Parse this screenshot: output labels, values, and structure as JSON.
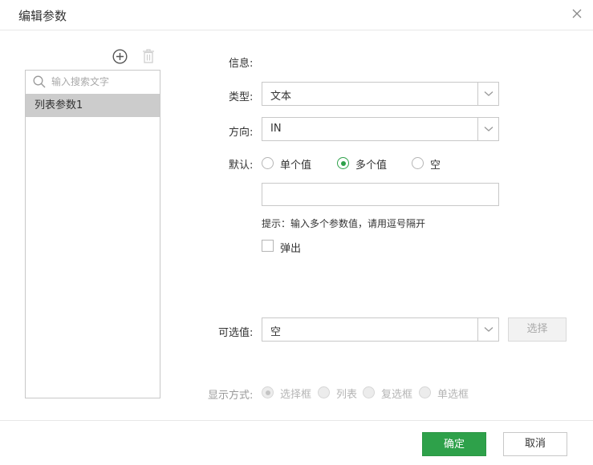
{
  "dialog": {
    "title": "编辑参数"
  },
  "left_panel": {
    "search_placeholder": "输入搜索文字",
    "items": [
      {
        "label": "列表参数1"
      }
    ]
  },
  "form": {
    "info_label": "信息:",
    "type_label": "类型:",
    "type_value": "文本",
    "direction_label": "方向:",
    "direction_value": "IN",
    "default_label": "默认:",
    "default_options": [
      "单个值",
      "多个值",
      "空"
    ],
    "default_selected": "多个值",
    "default_input_value": "",
    "hint": "提示：输入多个参数值，请用逗号隔开",
    "popup_label": "弹出",
    "optional_label": "可选值:",
    "optional_value": "空",
    "select_button": "选择",
    "display_label": "显示方式:",
    "display_options": [
      "选择框",
      "列表",
      "复选框",
      "单选框"
    ],
    "display_selected": "选择框"
  },
  "footer": {
    "ok_label": "确定",
    "cancel_label": "取消"
  },
  "colors": {
    "accent": "#2ea14a",
    "selected_row": "#cccccc",
    "border": "#c8c8c8"
  },
  "icons": [
    "close-icon",
    "add-circle-icon",
    "trash-icon",
    "search-icon",
    "chevron-down-icon"
  ]
}
